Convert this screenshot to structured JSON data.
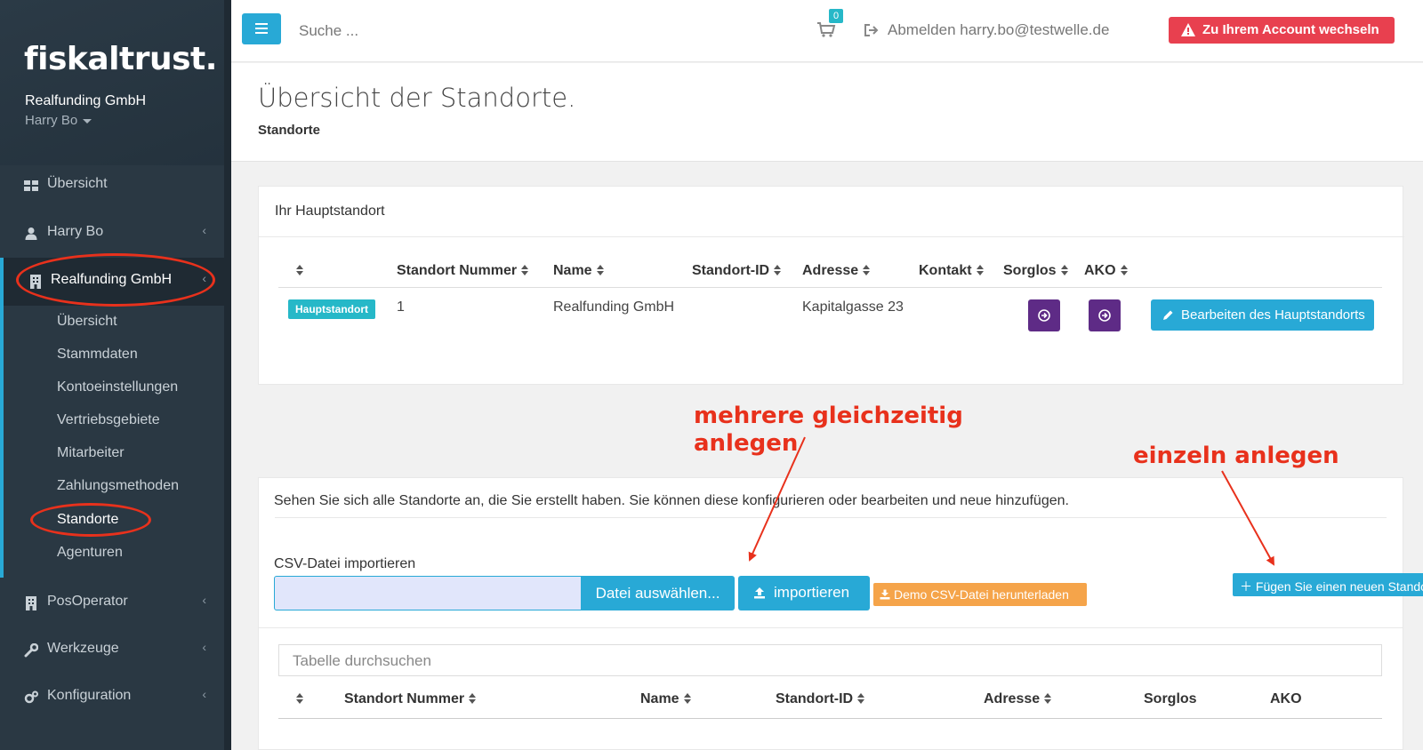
{
  "sidebar": {
    "logo": "fiskaltrust.",
    "company": "Realfunding GmbH",
    "user": "Harry Bo",
    "nav": [
      {
        "label": "Übersicht"
      },
      {
        "label": "Harry Bo"
      },
      {
        "label": "Realfunding GmbH"
      },
      {
        "label": "PosOperator"
      },
      {
        "label": "Werkzeuge"
      },
      {
        "label": "Konfiguration"
      }
    ],
    "sub": [
      "Übersicht",
      "Stammdaten",
      "Kontoeinstellungen",
      "Vertriebsgebiete",
      "Mitarbeiter",
      "Zahlungsmethoden",
      "Standorte",
      "Agenturen"
    ]
  },
  "topbar": {
    "search_placeholder": "Suche ...",
    "cart_count": "0",
    "logout": "Abmelden harry.bo@testwelle.de",
    "switch_account": "Zu Ihrem Account wechseln"
  },
  "header": {
    "title": "Übersicht der Standorte.",
    "breadcrumb": "Standorte"
  },
  "main_location": {
    "heading": "Ihr Hauptstandort",
    "columns": [
      "Standort Nummer",
      "Name",
      "Standort-ID",
      "Adresse",
      "Kontakt",
      "Sorglos",
      "AKO"
    ],
    "row": {
      "badge": "Hauptstandort",
      "number": "1",
      "name": "Realfunding GmbH",
      "address": "Kapitalgasse 23"
    },
    "edit_button": "Bearbeiten des Hauptstandorts"
  },
  "locations": {
    "description": "Sehen Sie sich alle Standorte an, die Sie erstellt haben. Sie können diese konfigurieren oder bearbeiten und neue hinzufügen.",
    "csv_label": "CSV-Datei importieren",
    "choose_file": "Datei auswählen...",
    "import": "importieren",
    "demo_csv": "Demo CSV-Datei herunterladen",
    "add_new": "Fügen Sie einen neuen Standort",
    "table_search_placeholder": "Tabelle durchsuchen",
    "columns": [
      "Standort Nummer",
      "Name",
      "Standort-ID",
      "Adresse",
      "Sorglos",
      "AKO"
    ]
  },
  "annotations": {
    "multi_line1": "mehrere gleichzeitig",
    "multi_line2": "anlegen",
    "single": "einzeln anlegen"
  },
  "colors": {
    "accent": "#28a9d6",
    "danger": "#e8404f",
    "purple": "#5e2b86",
    "warning": "#f5a44a",
    "annotation": "#e8311c",
    "sidebar": "#2a3843"
  }
}
